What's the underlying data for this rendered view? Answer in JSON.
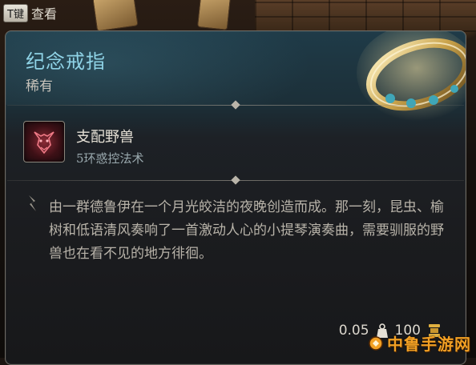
{
  "hotkey": {
    "key": "T键",
    "label": "查看"
  },
  "item": {
    "name": "纪念戒指",
    "rarity": "稀有",
    "spell": {
      "name": "支配野兽",
      "level": "5环惑控法术",
      "icon": "beast-face-icon"
    },
    "description": "由一群德鲁伊在一个月光皎洁的夜晚创造而成。那一刻，昆虫、榆树和低语清风奏响了一首激动人心的小提琴演奏曲，需要驯服的野兽也在看不见的地方徘徊。",
    "weight": "0.05",
    "value": "100"
  },
  "watermark": {
    "text": "中鲁手游网"
  },
  "colors": {
    "title": "#8fd3e6",
    "body": "#b8b3a9",
    "gold": "#e0b040"
  }
}
